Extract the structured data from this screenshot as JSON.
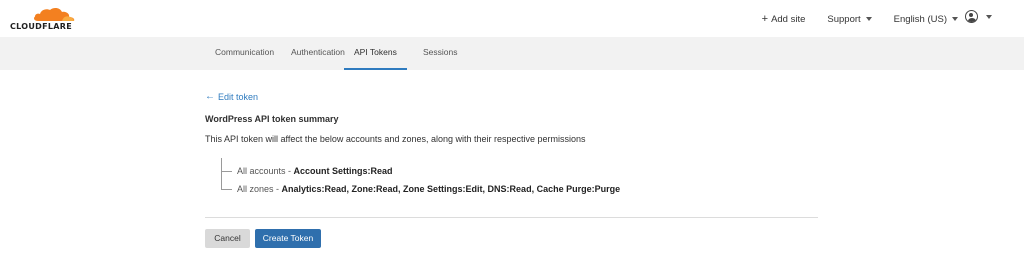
{
  "brand": {
    "logo_text": "CLOUDFLARE",
    "logo_color": "#f38020"
  },
  "header": {
    "add_site": "Add site",
    "support": "Support",
    "language": "English (US)"
  },
  "tabs": [
    {
      "label": "Communication",
      "active": false
    },
    {
      "label": "Authentication",
      "active": false
    },
    {
      "label": "API Tokens",
      "active": true
    },
    {
      "label": "Sessions",
      "active": false
    }
  ],
  "content": {
    "back_link": "Edit token",
    "summary_title": "WordPress API token summary",
    "summary_desc": "This API token will affect the below accounts and zones, along with their respective permissions",
    "rows": [
      {
        "scope": "All accounts",
        "separator": " - ",
        "permissions": "Account Settings:Read"
      },
      {
        "scope": "All zones",
        "separator": " - ",
        "permissions": "Analytics:Read, Zone:Read, Zone Settings:Edit, DNS:Read, Cache Purge:Purge"
      }
    ]
  },
  "actions": {
    "cancel": "Cancel",
    "create": "Create Token"
  },
  "colors": {
    "accent": "#2f7bbf",
    "primary_button": "#2f6fad",
    "tab_bar": "#f2f2f2"
  }
}
